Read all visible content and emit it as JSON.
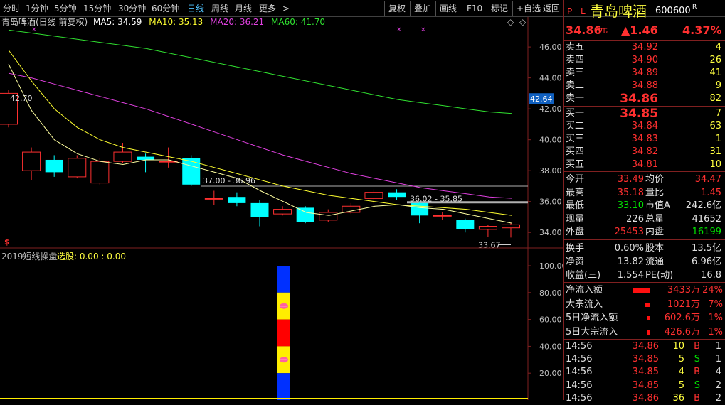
{
  "toolbar": {
    "periods": [
      "分时",
      "1分钟",
      "5分钟",
      "15分钟",
      "30分钟",
      "60分钟",
      "日线",
      "周线",
      "月线"
    ],
    "active": "日线",
    "more": "更多",
    "more_arrow": ">",
    "actions": [
      "复权",
      "叠加",
      "画线",
      "F10",
      "标记",
      "+自选",
      "返回"
    ]
  },
  "stock": {
    "name": "青岛啤酒",
    "code": "600600",
    "badge": "R",
    "pl_label": "P L",
    "price": "34.86",
    "price_unit": "元",
    "change": "▲1.46",
    "change_pct": "4.37%"
  },
  "chart_info": {
    "title": "青岛啤酒(日线 前复权)",
    "ma5": "MA5: 34.59",
    "ma10": "MA10: 35.13",
    "ma20": "MA20: 36.21",
    "ma60": "MA60: 41.70",
    "diamond": "◇",
    "arrows": "◇"
  },
  "chart_data": [
    {
      "type": "candlestick",
      "y_ticks": [
        "46.00",
        "44.00",
        "42.00",
        "40.00",
        "38.00",
        "36.00",
        "34.00"
      ],
      "ylim": [
        33.0,
        47.2
      ],
      "current_price_marker": "42.64",
      "candles": [
        {
          "o": 41.0,
          "c": 43.0,
          "h": 43.2,
          "l": 40.8
        },
        {
          "o": 38.0,
          "c": 39.2,
          "h": 39.5,
          "l": 37.4
        },
        {
          "o": 38.7,
          "c": 37.9,
          "h": 39.0,
          "l": 37.6
        },
        {
          "o": 37.6,
          "c": 38.8,
          "h": 39.0,
          "l": 37.5
        },
        {
          "o": 37.2,
          "c": 38.6,
          "h": 38.8,
          "l": 37.1
        },
        {
          "o": 38.6,
          "c": 39.2,
          "h": 39.8,
          "l": 38.5
        },
        {
          "o": 38.9,
          "c": 38.7,
          "h": 39.1,
          "l": 37.9
        },
        {
          "o": 38.6,
          "c": 38.6,
          "h": 39.5,
          "l": 38.2
        },
        {
          "o": 38.8,
          "c": 37.1,
          "h": 39.0,
          "l": 37.0
        },
        {
          "o": 36.2,
          "c": 36.2,
          "h": 36.7,
          "l": 35.8
        },
        {
          "o": 36.3,
          "c": 35.9,
          "h": 36.6,
          "l": 35.7
        },
        {
          "o": 35.9,
          "c": 35.0,
          "h": 36.1,
          "l": 34.4
        },
        {
          "o": 35.2,
          "c": 35.5,
          "h": 35.7,
          "l": 35.1
        },
        {
          "o": 35.6,
          "c": 34.7,
          "h": 35.7,
          "l": 34.6
        },
        {
          "o": 34.8,
          "c": 35.3,
          "h": 35.5,
          "l": 34.7
        },
        {
          "o": 35.3,
          "c": 35.7,
          "h": 35.9,
          "l": 35.2
        },
        {
          "o": 36.2,
          "c": 36.6,
          "h": 36.8,
          "l": 35.6
        },
        {
          "o": 36.6,
          "c": 36.3,
          "h": 36.8,
          "l": 36.1
        },
        {
          "o": 35.9,
          "c": 35.1,
          "h": 36.0,
          "l": 34.6
        },
        {
          "o": 35.1,
          "c": 35.1,
          "h": 35.3,
          "l": 34.8
        },
        {
          "o": 34.8,
          "c": 34.2,
          "h": 34.9,
          "l": 34.0
        },
        {
          "o": 34.2,
          "c": 34.4,
          "h": 34.5,
          "l": 33.7
        },
        {
          "o": 34.3,
          "c": 34.5,
          "h": 34.6,
          "l": 33.67
        }
      ],
      "ma5": [
        44.9,
        41.9,
        40.0,
        39.1,
        38.6,
        38.4,
        38.7,
        38.7,
        38.3,
        37.9,
        37.5,
        36.7,
        36.0,
        35.3,
        35.1,
        35.4,
        35.7,
        35.8,
        35.6,
        35.5,
        35.2,
        34.9,
        34.6
      ],
      "ma10": [
        45.8,
        43.8,
        42.0,
        40.8,
        40.0,
        39.5,
        39.2,
        38.9,
        38.6,
        38.2,
        37.8,
        37.4,
        37.0,
        36.7,
        36.4,
        36.2,
        36.0,
        35.8,
        35.7,
        35.6,
        35.5,
        35.3,
        35.1
      ],
      "ma20": [
        44.3,
        44.0,
        43.6,
        43.2,
        42.8,
        42.4,
        42.0,
        41.5,
        41.0,
        40.5,
        40.0,
        39.5,
        39.0,
        38.6,
        38.2,
        37.8,
        37.5,
        37.2,
        36.9,
        36.7,
        36.5,
        36.3,
        36.21
      ],
      "ma60": [
        47.1,
        46.9,
        46.7,
        46.5,
        46.3,
        46.1,
        45.9,
        45.6,
        45.3,
        45.0,
        44.7,
        44.4,
        44.1,
        43.8,
        43.5,
        43.2,
        42.9,
        42.6,
        42.4,
        42.2,
        42.0,
        41.8,
        41.7
      ],
      "annotations": [
        "42.70",
        "37.00 - 36.96",
        "36.02 - 35.85",
        "33.67"
      ]
    },
    {
      "type": "bar",
      "title": "2019短线操盘",
      "pick": "选股: 0.00 : 0.00",
      "y_ticks": [
        "100.00",
        "80.00",
        "60.00",
        "40.00",
        "20.00"
      ],
      "ylim": [
        0,
        100
      ],
      "segments": [
        {
          "from": 100,
          "to": 80,
          "color": "#0030ff"
        },
        {
          "from": 80,
          "to": 60,
          "color": "#ffee00"
        },
        {
          "from": 60,
          "to": 40,
          "color": "#ff0000"
        },
        {
          "from": 40,
          "to": 20,
          "color": "#ffee00"
        },
        {
          "from": 20,
          "to": 0,
          "color": "#0030ff"
        }
      ]
    }
  ],
  "orderbook": {
    "sell": [
      {
        "label": "卖五",
        "price": "34.92",
        "vol": "4"
      },
      {
        "label": "卖四",
        "price": "34.90",
        "vol": "26"
      },
      {
        "label": "卖三",
        "price": "34.89",
        "vol": "41"
      },
      {
        "label": "卖二",
        "price": "34.88",
        "vol": "9"
      },
      {
        "label": "卖一",
        "price": "34.86",
        "vol": "82"
      }
    ],
    "buy": [
      {
        "label": "买一",
        "price": "34.85",
        "vol": "7"
      },
      {
        "label": "买二",
        "price": "34.84",
        "vol": "63"
      },
      {
        "label": "买三",
        "price": "34.83",
        "vol": "1"
      },
      {
        "label": "买四",
        "price": "34.82",
        "vol": "31"
      },
      {
        "label": "买五",
        "price": "34.81",
        "vol": "10"
      }
    ]
  },
  "stats": [
    {
      "l1": "今开",
      "v1": "33.49",
      "c1": "red",
      "l2": "均价",
      "v2": "34.47",
      "c2": "red"
    },
    {
      "l1": "最高",
      "v1": "35.18",
      "c1": "red",
      "l2": "量比",
      "v2": "1.45",
      "c2": "red"
    },
    {
      "l1": "最低",
      "v1": "33.10",
      "c1": "green",
      "l2": "市值A",
      "v2": "242.6亿",
      "c2": "wh"
    },
    {
      "l1": "现量",
      "v1": "226",
      "c1": "wh",
      "l2": "总量",
      "v2": "41652",
      "c2": "wh"
    },
    {
      "l1": "外盘",
      "v1": "25453",
      "c1": "red",
      "l2": "内盘",
      "v2": "16199",
      "c2": "green"
    }
  ],
  "stats2": [
    {
      "l1": "换手",
      "v1": "0.60%",
      "l2": "股本",
      "v2": "13.5亿"
    },
    {
      "l1": "净资",
      "v1": "13.82",
      "l2": "流通",
      "v2": "6.96亿"
    },
    {
      "l1": "收益(三)",
      "v1": "1.554",
      "l2": "PE(动)",
      "v2": "16.8"
    }
  ],
  "flows": [
    {
      "label": "净流入额",
      "value": "3433万",
      "pct": "24%",
      "bar": 0.24
    },
    {
      "label": "大宗流入",
      "value": "1021万",
      "pct": "7%",
      "bar": 0.07
    },
    {
      "label": "5日净流入额",
      "value": "602.6万",
      "pct": "1%",
      "bar": 0.01
    },
    {
      "label": "5日大宗流入",
      "value": "426.6万",
      "pct": "1%",
      "bar": 0.01
    }
  ],
  "ticks": [
    {
      "t": "14:56",
      "p": "34.86",
      "v": "10",
      "bs": "B",
      "n": "1"
    },
    {
      "t": "14:56",
      "p": "34.85",
      "v": "5",
      "bs": "S",
      "n": "1"
    },
    {
      "t": "14:56",
      "p": "34.85",
      "v": "4",
      "bs": "B",
      "n": "4"
    },
    {
      "t": "14:56",
      "p": "34.85",
      "v": "5",
      "bs": "S",
      "n": "2"
    },
    {
      "t": "14:56",
      "p": "34.86",
      "v": "36",
      "bs": "B",
      "n": "2"
    }
  ],
  "colors": {
    "up": "#ff3030",
    "down": "#00ffff",
    "ma5": "#ffffa0",
    "ma10": "#ffff30",
    "ma20": "#e040e0",
    "ma60": "#30e030"
  }
}
